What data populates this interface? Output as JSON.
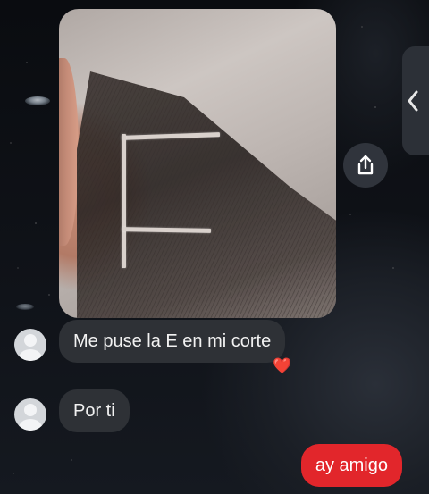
{
  "conversation": {
    "messages": [
      {
        "sender": "other",
        "type": "photo"
      },
      {
        "sender": "other",
        "type": "text",
        "text": "Me puse la E en mi corte",
        "reaction": "❤️"
      },
      {
        "sender": "other",
        "type": "text",
        "text": "Por ti"
      },
      {
        "sender": "me",
        "type": "text",
        "text": "ay amigo"
      }
    ]
  },
  "icons": {
    "share": "share-icon",
    "panel_toggle": "chevron-left-icon",
    "avatar": "default-avatar-icon"
  },
  "colors": {
    "incoming_bubble": "#2e3136",
    "outgoing_bubble": "#e2262b",
    "heart": "#ff2f4a"
  }
}
